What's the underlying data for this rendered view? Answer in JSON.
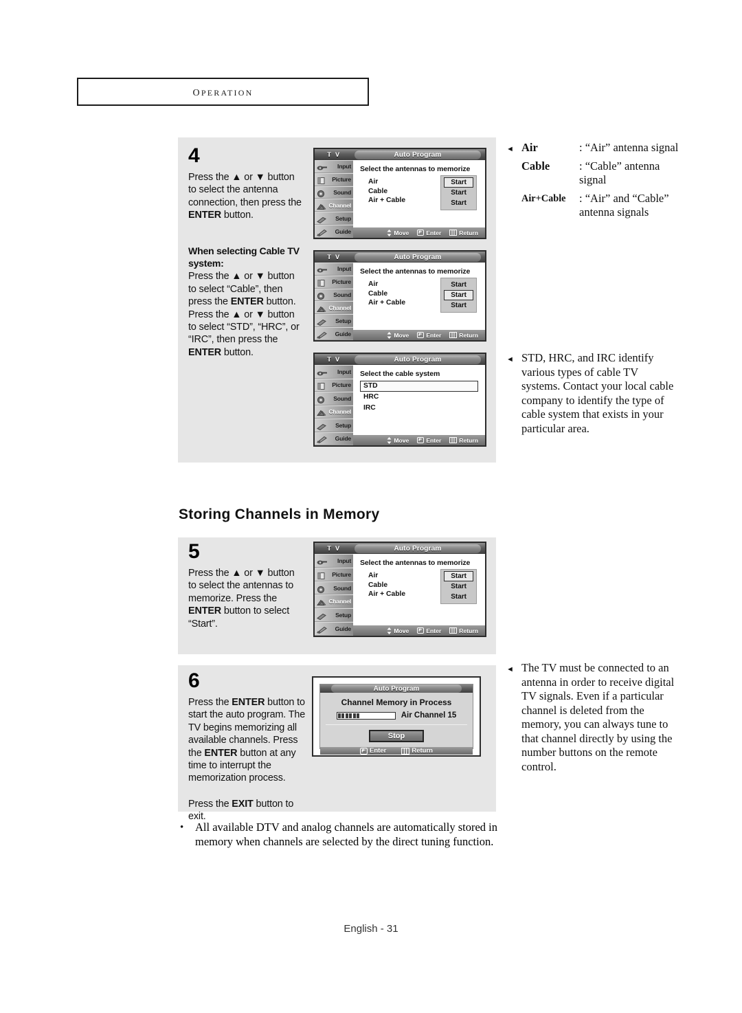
{
  "header": {
    "title": "Operation"
  },
  "steps": {
    "step4": {
      "number": "4",
      "body": "Press the ▲ or ▼ button to select the antenna connection, then press the ",
      "body_bold": "ENTER",
      "body_tail": " button.",
      "sub_lead": "When selecting Cable TV system:",
      "sub_line1": "Press the ▲ or ▼ button to select “Cable”, then press the ",
      "sub_bold1": "ENTER",
      "sub_line2": " button. Press the ▲ or ▼ button to select “STD”, “HRC”, or “IRC”, then press the ",
      "sub_bold2": "ENTER",
      "sub_line3": " button."
    },
    "step5": {
      "number": "5",
      "line1": "Press the ▲ or ▼ button to select the antennas to memorize. Press the ",
      "bold1": "ENTER",
      "line2": " button to select “Start”."
    },
    "step6": {
      "number": "6",
      "p1a": "Press the ",
      "p1b": "ENTER",
      "p1c": " button to start the auto program. The TV begins memorizing all available channels. Press the ",
      "p1d": "ENTER",
      "p1e": " button at any time to interrupt the memorization process.",
      "p2a": "Press the ",
      "p2b": "EXIT",
      "p2c": " button to exit."
    }
  },
  "section_heading": "Storing Channels in Memory",
  "notes": {
    "antenna_defs": [
      {
        "term": "Air",
        "def": ": “Air” antenna signal"
      },
      {
        "term": "Cable",
        "def": ": “Cable” antenna signal"
      },
      {
        "term": "Air+Cable",
        "def": ": “Air” and “Cable” antenna signals"
      }
    ],
    "cable_systems": "STD, HRC, and IRC identify various types of cable TV systems. Contact your local cable company to identify the type of cable system that exists in your particular area.",
    "antenna_required": "The TV must be connected to an antenna in order to receive digital TV signals. Even if a particular channel is deleted from the memory, you can always tune to that channel directly by using the number buttons on the remote control."
  },
  "bottom_bullet": "All available DTV and analog channels are automatically stored in memory when channels are selected by the direct tuning function.",
  "footer": {
    "page_label": "English - 31"
  },
  "osd": {
    "tv_label": "T V",
    "title": "Auto Program",
    "menu_items": [
      {
        "label": "Input",
        "icon": "input-icon"
      },
      {
        "label": "Picture",
        "icon": "picture-icon"
      },
      {
        "label": "Sound",
        "icon": "sound-icon"
      },
      {
        "label": "Channel",
        "icon": "channel-icon"
      },
      {
        "label": "Setup",
        "icon": "setup-icon"
      },
      {
        "label": "Guide",
        "icon": "guide-icon"
      }
    ],
    "selected_menu": "Channel",
    "antenna_screen": {
      "heading": "Select the antennas to memorize",
      "rows": [
        "Air",
        "Cable",
        "Air + Cable"
      ],
      "button_label": "Start"
    },
    "cable_screen": {
      "heading": "Select the cable system",
      "options": [
        "STD",
        "HRC",
        "IRC"
      ],
      "selected": "STD"
    },
    "footer_actions": [
      {
        "label": "Move",
        "icon": "updown-arrows-icon"
      },
      {
        "label": "Enter",
        "icon": "enter-key-icon"
      },
      {
        "label": "Return",
        "icon": "return-key-icon"
      }
    ],
    "dialog": {
      "title": "Auto Program",
      "heading": "Channel Memory in Process",
      "channel_text": "Air Channel 15",
      "progress_filled": 6,
      "progress_total": 15,
      "stop_label": "Stop",
      "footer_actions": [
        {
          "label": "Enter",
          "icon": "enter-key-icon"
        },
        {
          "label": "Return",
          "icon": "return-key-icon"
        }
      ]
    }
  }
}
